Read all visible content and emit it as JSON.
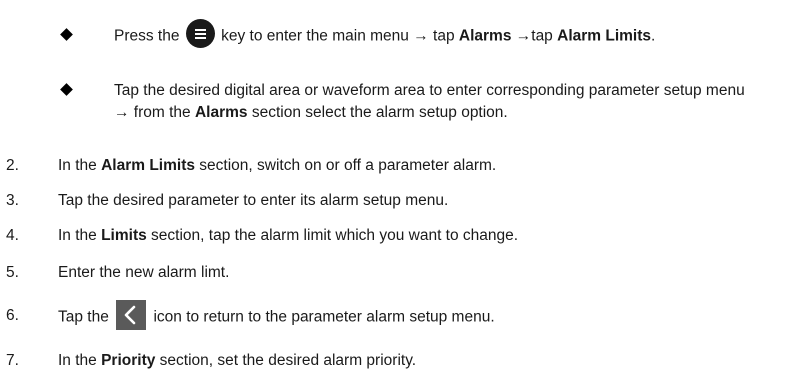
{
  "bullets": [
    {
      "pre": "Press the ",
      "icon": "menu-key-icon",
      "mid": " key to enter the main menu → tap ",
      "b1": "Alarms",
      "mid2": " →tap ",
      "b2": "Alarm Limits",
      "post": "."
    },
    {
      "pre": "Tap the desired digital area or waveform area to enter corresponding parameter setup menu → from the ",
      "b1": "Alarms",
      "post": " section select the alarm setup option."
    }
  ],
  "steps": [
    {
      "num": "2.",
      "pre": "In the ",
      "bold": "Alarm Limits",
      "post": " section, switch on or off a parameter alarm."
    },
    {
      "num": "3.",
      "pre": "Tap the desired parameter to enter its alarm setup menu."
    },
    {
      "num": "4.",
      "pre": "In the ",
      "bold": "Limits",
      "post": " section, tap the alarm limit which you want to change."
    },
    {
      "num": "5.",
      "pre": "Enter the new alarm limt."
    },
    {
      "num": "6.",
      "pre": "Tap the ",
      "icon": "back-arrow-icon",
      "post": " icon to return to the parameter alarm setup menu."
    },
    {
      "num": "7.",
      "pre": "In the ",
      "bold": "Priority",
      "post": " section, set the desired alarm priority."
    }
  ]
}
